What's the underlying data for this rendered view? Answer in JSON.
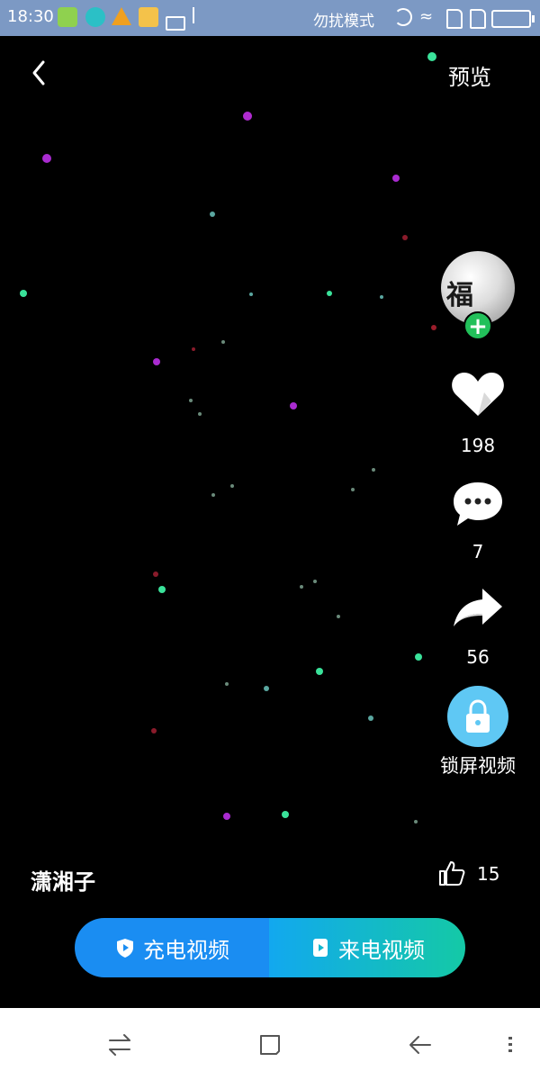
{
  "status_bar": {
    "time": "18:30",
    "dnd_label": "勿扰模式"
  },
  "top_bar": {
    "preview_label": "预览"
  },
  "actions": {
    "avatar_text": "福",
    "follow_plus": "+",
    "like_count": "198",
    "comment_count": "7",
    "share_count": "56",
    "lock_label": "锁屏视频"
  },
  "info": {
    "author": "潇湘子",
    "thumbs_count": "15"
  },
  "buttons": {
    "charge_label": "充电视频",
    "call_label": "来电视频"
  },
  "colors": {
    "status_bar": "#7c99c4",
    "charge_button": "#1a8df2",
    "call_button_start": "#12a8ef",
    "call_button_end": "#14c9a6",
    "lock_button": "#5fc8f4",
    "follow_plus": "#22c05a"
  },
  "icons": [
    "back-icon",
    "heart-icon",
    "comment-icon",
    "share-icon",
    "lock-icon",
    "thumb-up-icon",
    "shield-play-icon",
    "phone-play-icon",
    "recent-apps-icon",
    "home-icon",
    "back-nav-icon",
    "menu-icon"
  ]
}
